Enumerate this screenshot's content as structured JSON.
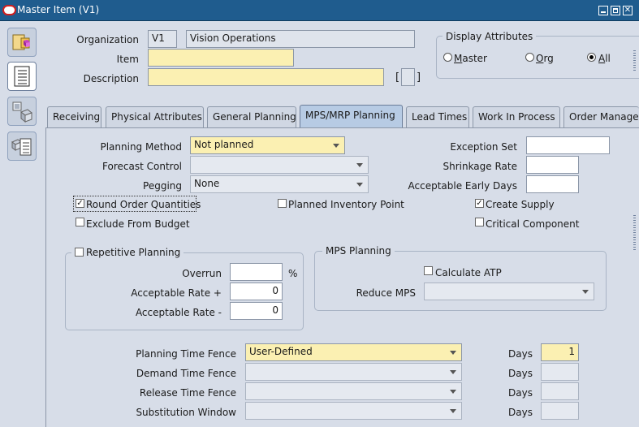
{
  "window": {
    "title": "Master Item (V1)",
    "controls": [
      "minimize",
      "maximize",
      "close"
    ]
  },
  "toolbar": {
    "icons": [
      "folder-3d-icon",
      "document-list-icon",
      "item-org-icon",
      "catalog-icon"
    ]
  },
  "header": {
    "organization_label": "Organization",
    "organization_code": "V1",
    "organization_name": "Vision Operations",
    "item_label": "Item",
    "item_value": "",
    "description_label": "Description",
    "description_value": "",
    "flex_bracket_open": "[",
    "flex_bracket_close": "]"
  },
  "display_attributes": {
    "title": "Display Attributes",
    "options": [
      {
        "label": "Master",
        "mnemonic": "M",
        "rest": "aster",
        "selected": false
      },
      {
        "label": "Org",
        "mnemonic": "O",
        "rest": "rg",
        "selected": false
      },
      {
        "label": "All",
        "mnemonic": "A",
        "rest": "ll",
        "selected": true
      }
    ]
  },
  "tabs": [
    {
      "label": "Receiving",
      "active": false
    },
    {
      "label": "Physical Attributes",
      "active": false
    },
    {
      "label": "General Planning",
      "active": false
    },
    {
      "label": "MPS/MRP Planning",
      "active": true
    },
    {
      "label": "Lead Times",
      "active": false
    },
    {
      "label": "Work In Process",
      "active": false
    },
    {
      "label": "Order Manage",
      "active": false
    }
  ],
  "planning": {
    "planning_method_label": "Planning Method",
    "planning_method_value": "Not planned",
    "forecast_control_label": "Forecast Control",
    "forecast_control_value": "",
    "pegging_label": "Pegging",
    "pegging_value": "None",
    "exception_set_label": "Exception Set",
    "exception_set_value": "",
    "shrinkage_rate_label": "Shrinkage Rate",
    "shrinkage_rate_value": "",
    "acceptable_early_days_label": "Acceptable Early Days",
    "acceptable_early_days_value": ""
  },
  "checkboxes": {
    "round_order_quantities": {
      "label": "Round Order Quantities",
      "checked": true
    },
    "exclude_from_budget": {
      "label": "Exclude From Budget",
      "checked": false
    },
    "planned_inventory_point": {
      "label": "Planned Inventory Point",
      "checked": false
    },
    "create_supply": {
      "label": "Create Supply",
      "checked": true
    },
    "critical_component": {
      "label": "Critical Component",
      "checked": false
    }
  },
  "repetitive_planning": {
    "title": "Repetitive Planning",
    "checked": false,
    "overrun_label": "Overrun",
    "overrun_value": "",
    "overrun_unit": "%",
    "acceptable_rate_plus_label": "Acceptable Rate +",
    "acceptable_rate_plus_value": "0",
    "acceptable_rate_minus_label": "Acceptable Rate -",
    "acceptable_rate_minus_value": "0"
  },
  "mps_planning": {
    "title": "MPS Planning",
    "calculate_atp_label": "Calculate ATP",
    "calculate_atp_checked": false,
    "reduce_mps_label": "Reduce MPS",
    "reduce_mps_value": ""
  },
  "time_fences": {
    "planning_label": "Planning Time Fence",
    "planning_value": "User-Defined",
    "planning_days": "1",
    "demand_label": "Demand Time Fence",
    "demand_value": "",
    "demand_days": "",
    "release_label": "Release Time Fence",
    "release_value": "",
    "release_days": "",
    "substitution_label": "Substitution Window",
    "substitution_value": "",
    "substitution_days": "",
    "days_label": "Days"
  },
  "colors": {
    "title_bar": "#1f5c8e",
    "background": "#d7dde8",
    "required_field": "#fbf0b2",
    "active_tab": "#b7cbe4"
  }
}
